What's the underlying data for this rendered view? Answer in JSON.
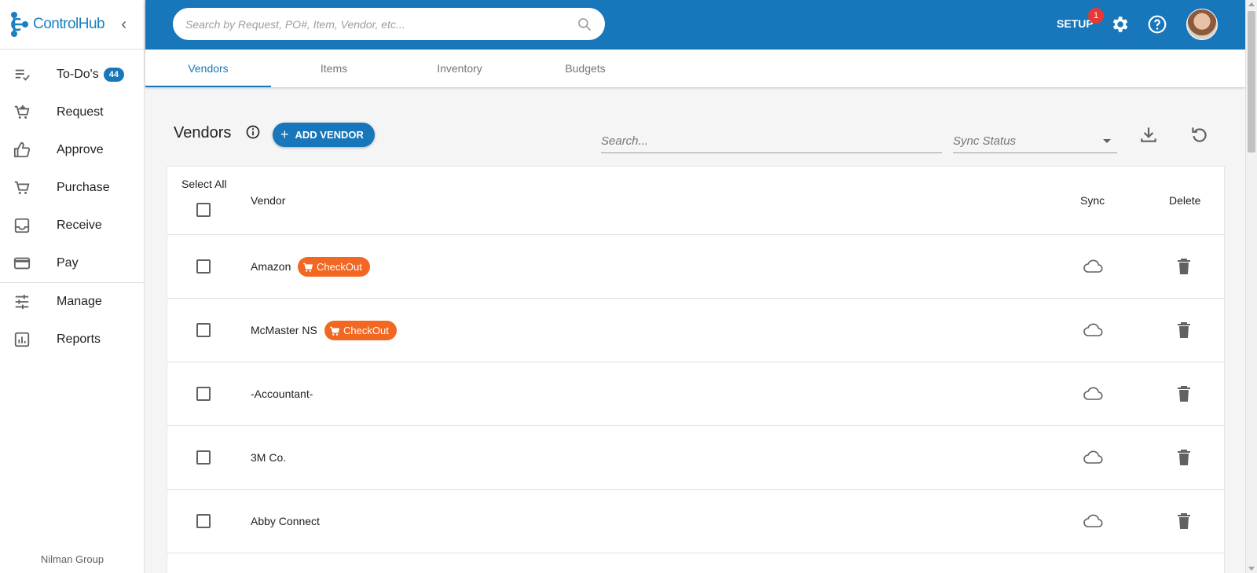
{
  "app": {
    "name": "ControlHub",
    "org": "Nilman Group"
  },
  "sidebar": {
    "items": [
      {
        "label": "To-Do's",
        "icon": "todo-list-icon",
        "badge": "44"
      },
      {
        "label": "Request",
        "icon": "cart-add-icon"
      },
      {
        "label": "Approve",
        "icon": "thumbs-up-icon"
      },
      {
        "label": "Purchase",
        "icon": "cart-icon"
      },
      {
        "label": "Receive",
        "icon": "inbox-icon"
      },
      {
        "label": "Pay",
        "icon": "credit-card-icon"
      },
      {
        "label": "Manage",
        "icon": "sliders-icon"
      },
      {
        "label": "Reports",
        "icon": "bar-chart-icon"
      }
    ]
  },
  "header": {
    "search_placeholder": "Search by Request, PO#, Item, Vendor, etc...",
    "setup_label": "SETUP",
    "setup_badge": "1"
  },
  "tabs": [
    {
      "label": "Vendors",
      "active": true
    },
    {
      "label": "Items",
      "active": false
    },
    {
      "label": "Inventory",
      "active": false
    },
    {
      "label": "Budgets",
      "active": false
    }
  ],
  "page": {
    "title": "Vendors",
    "add_button_label": "ADD VENDOR",
    "search_placeholder": "Search...",
    "sync_status_placeholder": "Sync Status"
  },
  "table": {
    "select_all_label": "Select All",
    "col_vendor": "Vendor",
    "col_sync": "Sync",
    "col_delete": "Delete",
    "checkout_label": "CheckOut",
    "rows": [
      {
        "vendor": "Amazon",
        "checkout": true
      },
      {
        "vendor": "McMaster NS",
        "checkout": true
      },
      {
        "vendor": "-Accountant-",
        "checkout": false
      },
      {
        "vendor": "3M Co.",
        "checkout": false
      },
      {
        "vendor": "Abby Connect",
        "checkout": false
      }
    ]
  },
  "colors": {
    "primary": "#1876ba",
    "checkout": "#f26722",
    "badge_red": "#e53935"
  }
}
